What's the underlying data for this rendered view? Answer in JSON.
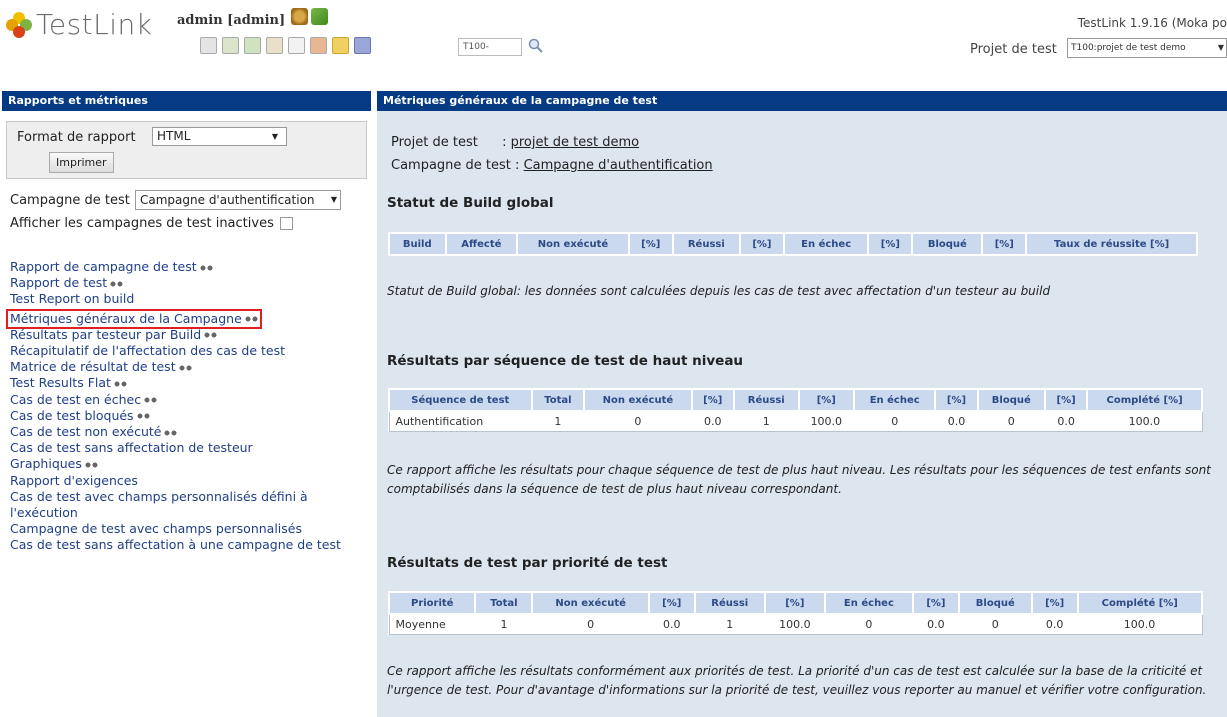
{
  "header": {
    "logo_text": "TestLink",
    "user": "admin [admin]",
    "version": "TestLink 1.9.16 (Moka po",
    "tc_input_value": "T100-",
    "project_label": "Projet de test",
    "project_value": "T100:projet de test demo"
  },
  "left": {
    "title": "Rapports et métriques",
    "format_label": "Format de rapport",
    "format_value": "HTML",
    "print_label": "Imprimer",
    "campaign_label": "Campagne de test",
    "campaign_value": "Campagne d'authentification",
    "inactive_label": "Afficher les campagnes de test inactives",
    "links": [
      {
        "label": "Rapport de campagne de test",
        "glasses": true
      },
      {
        "label": "Rapport de test",
        "glasses": true
      },
      {
        "label": "Test Report on build",
        "glasses": false
      },
      {
        "label": "Métriques généraux de la Campagne",
        "glasses": true
      },
      {
        "label": "Résultats par testeur par Build",
        "glasses": true
      },
      {
        "label": "Récapitulatif de l'affectation des cas de test",
        "glasses": false
      },
      {
        "label": "Matrice de résultat de test",
        "glasses": true
      },
      {
        "label": "Test Results Flat",
        "glasses": true
      },
      {
        "label": "Cas de test en échec",
        "glasses": true
      },
      {
        "label": "Cas de test bloqués",
        "glasses": true
      },
      {
        "label": "Cas de test non exécuté",
        "glasses": true
      },
      {
        "label": "Cas de test sans affectation de testeur",
        "glasses": false
      },
      {
        "label": "Graphiques",
        "glasses": true
      },
      {
        "label": "Rapport d'exigences",
        "glasses": false
      },
      {
        "label": "Cas de test avec champs personnalisés défini à l'exécution",
        "glasses": false
      },
      {
        "label": "Campagne de test avec champs personnalisés",
        "glasses": false
      },
      {
        "label": "Cas de test sans affectation à une campagne de test",
        "glasses": false
      }
    ]
  },
  "main": {
    "title": "Métriques généraux de la campagne de test",
    "project_label": "Projet de test",
    "project_sep": ":",
    "project_value": "projet de test demo",
    "campaign_label": "Campagne de test :",
    "campaign_value": "Campagne d'authentification",
    "build_section": {
      "title": "Statut de Build global",
      "headers": [
        "Build",
        "Affecté",
        "Non exécuté",
        "[%]",
        "Réussi",
        "[%]",
        "En échec",
        "[%]",
        "Bloqué",
        "[%]",
        "Taux de réussite [%]"
      ],
      "note": "Statut de Build global: les données sont calculées depuis les cas de test avec affectation d'un testeur au build"
    },
    "suite_section": {
      "title": "Résultats par séquence de test de haut niveau",
      "headers": [
        "Séquence de test",
        "Total",
        "Non exécuté",
        "[%]",
        "Réussi",
        "[%]",
        "En échec",
        "[%]",
        "Bloqué",
        "[%]",
        "Complété [%]"
      ],
      "rows": [
        [
          "Authentification",
          "1",
          "0",
          "0.0",
          "1",
          "100.0",
          "0",
          "0.0",
          "0",
          "0.0",
          "100.0"
        ]
      ],
      "note": "Ce rapport affiche les résultats pour chaque séquence de test de plus haut niveau. Les résultats pour les séquences de test enfants sont comptabilisés dans la séquence de test de plus haut niveau correspondant."
    },
    "priority_section": {
      "title": "Résultats de test par priorité de test",
      "headers": [
        "Priorité",
        "Total",
        "Non exécuté",
        "[%]",
        "Réussi",
        "[%]",
        "En échec",
        "[%]",
        "Bloqué",
        "[%]",
        "Complété [%]"
      ],
      "rows": [
        [
          "Moyenne",
          "1",
          "0",
          "0.0",
          "1",
          "100.0",
          "0",
          "0.0",
          "0",
          "0.0",
          "100.0"
        ]
      ],
      "note": "Ce rapport affiche les résultats conformément aux priorités de test. La priorité d'un cas de test est calculée sur la base de la criticité et l'urgence de test. Pour d'avantage d'informations sur la priorité de test, veuillez vous reporter au manuel et vérifier votre configuration."
    }
  },
  "colors": {
    "header_bar": "#053b84",
    "panel_bg": "#dde5ef",
    "table_header_bg": "#cbd9ee",
    "link": "#1f3f87",
    "highlight_border": "#e02020"
  }
}
